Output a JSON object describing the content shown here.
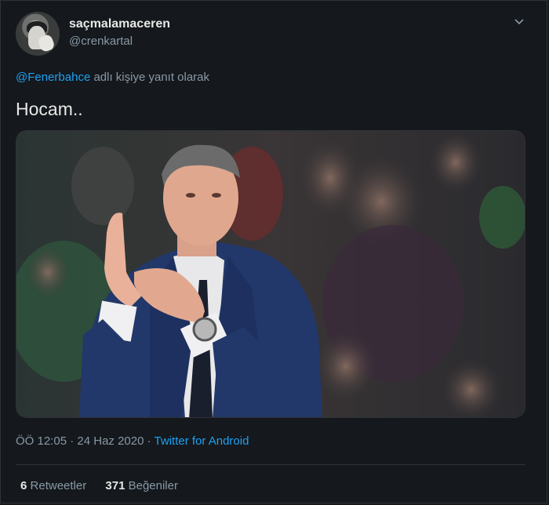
{
  "tweet": {
    "display_name": "saçmalamaceren",
    "handle": "@crenkartal",
    "reply_prefix": "@Fenerbahce",
    "reply_suffix": " adlı kişiye yanıt olarak",
    "text": "Hocam..",
    "time": "ÖÖ 12:05",
    "date": "24 Haz 2020",
    "source_app": "Twitter for Android",
    "retweet_count": "6",
    "retweet_label": "Retweetler",
    "like_count": "371",
    "like_label": "Beğeniler"
  },
  "icons": {
    "more": "chevron-down-icon"
  },
  "colors": {
    "background": "#15181c",
    "link": "#1da1f2",
    "muted": "#8899a6",
    "text": "#e8e8e8"
  }
}
